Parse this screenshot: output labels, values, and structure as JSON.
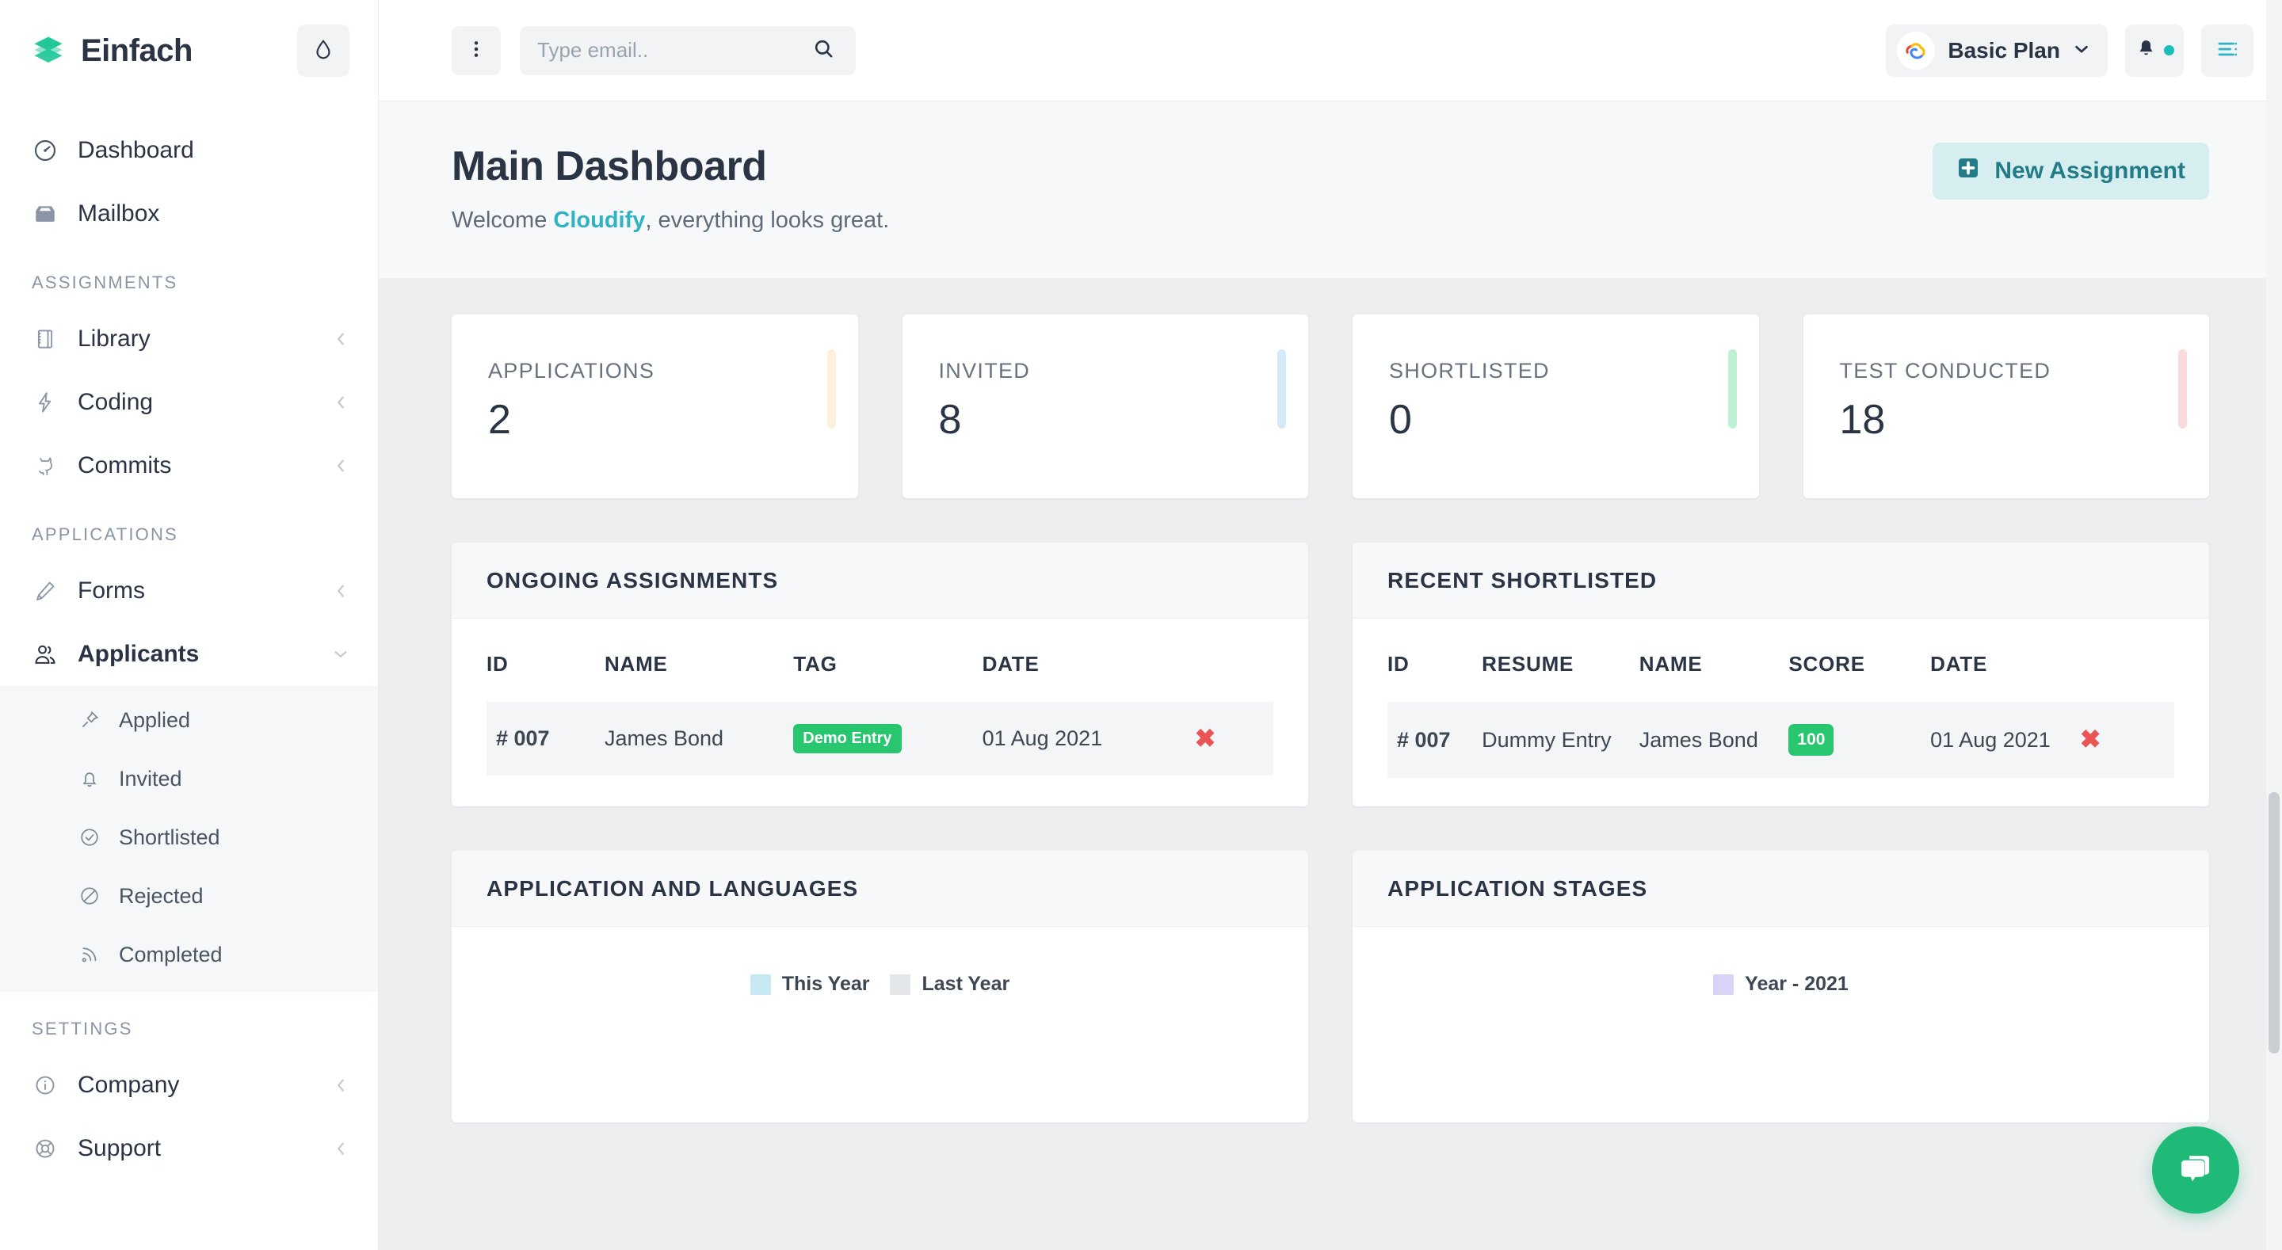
{
  "brand": {
    "name": "Einfach",
    "logo_icon": "layers-icon",
    "theme_toggle_icon": "water-drop-icon"
  },
  "sidebar": {
    "top_items": [
      {
        "label": "Dashboard",
        "icon": "speedometer-icon"
      },
      {
        "label": "Mailbox",
        "icon": "inbox-icon"
      }
    ],
    "sections": [
      {
        "title": "ASSIGNMENTS",
        "items": [
          {
            "label": "Library",
            "icon": "notebook-icon",
            "chevron": "left"
          },
          {
            "label": "Coding",
            "icon": "lightning-bolt-icon",
            "chevron": "left"
          },
          {
            "label": "Commits",
            "icon": "github-cat-icon",
            "chevron": "left"
          }
        ]
      },
      {
        "title": "APPLICATIONS",
        "items": [
          {
            "label": "Forms",
            "icon": "pencil-icon",
            "chevron": "left"
          },
          {
            "label": "Applicants",
            "icon": "users-icon",
            "chevron": "down",
            "active": true
          }
        ],
        "submenu": [
          {
            "label": "Applied",
            "icon": "pin-icon"
          },
          {
            "label": "Invited",
            "icon": "bell-icon"
          },
          {
            "label": "Shortlisted",
            "icon": "check-circle-icon"
          },
          {
            "label": "Rejected",
            "icon": "ban-icon"
          },
          {
            "label": "Completed",
            "icon": "rss-signal-icon"
          }
        ]
      },
      {
        "title": "SETTINGS",
        "items": [
          {
            "label": "Company",
            "icon": "info-circle-icon",
            "chevron": "left"
          },
          {
            "label": "Support",
            "icon": "life-buoy-icon",
            "chevron": "left"
          }
        ]
      }
    ]
  },
  "topbar": {
    "menu_dots_icon": "vertical-dots-icon",
    "search": {
      "placeholder": "Type email..",
      "value": "",
      "icon": "search-icon"
    },
    "plan": {
      "label": "Basic Plan",
      "logo_icon": "cloud-spiral-icon",
      "chevron_icon": "chevron-down-icon"
    },
    "notifications": {
      "icon": "bell-icon",
      "has_badge": true,
      "badge_color": "#17bebb"
    },
    "menu_toggle": {
      "icon": "list-menu-icon",
      "color": "#2fb3c4"
    }
  },
  "page": {
    "title": "Main Dashboard",
    "welcome_prefix": "Welcome ",
    "welcome_name": "Cloudify",
    "welcome_suffix": ", everything looks great.",
    "new_assignment_button": "New Assignment",
    "new_assignment_icon": "plus-square-icon"
  },
  "stats": [
    {
      "label": "APPLICATIONS",
      "value": "2",
      "bar_color": "#fdf0dd"
    },
    {
      "label": "INVITED",
      "value": "8",
      "bar_color": "#d5e9f8"
    },
    {
      "label": "SHORTLISTED",
      "value": "0",
      "bar_color": "#bdf0d5"
    },
    {
      "label": "TEST CONDUCTED",
      "value": "18",
      "bar_color": "#fbdada"
    }
  ],
  "ongoing_assignments": {
    "title": "ONGOING ASSIGNMENTS",
    "columns": [
      "ID",
      "NAME",
      "TAG",
      "DATE",
      ""
    ],
    "rows": [
      {
        "id": "# 007",
        "name": "James Bond",
        "tag": "Demo Entry",
        "date": "01 Aug 2021",
        "delete_icon": "close-x-icon"
      }
    ]
  },
  "recent_shortlisted": {
    "title": "RECENT SHORTLISTED",
    "columns": [
      "ID",
      "RESUME",
      "NAME",
      "SCORE",
      "DATE",
      ""
    ],
    "rows": [
      {
        "id": "# 007",
        "resume": "Dummy Entry",
        "name": "James Bond",
        "score": "100",
        "date": "01 Aug 2021",
        "delete_icon": "close-x-icon"
      }
    ]
  },
  "chart_data": [
    {
      "type": "bar",
      "title": "APPLICATION AND LANGUAGES",
      "legend": [
        {
          "name": "This Year",
          "color": "#c7e9f4"
        },
        {
          "name": "Last Year",
          "color": "#e4e7ea"
        }
      ],
      "legend_position": "top-center",
      "categories": [],
      "series": [
        {
          "name": "This Year",
          "values": []
        },
        {
          "name": "Last Year",
          "values": []
        }
      ],
      "xlabel": "",
      "ylabel": "",
      "grid": false
    },
    {
      "type": "bar",
      "title": "APPLICATION STAGES",
      "legend": [
        {
          "name": "Year -  2021",
          "color": "#d9d4f7"
        }
      ],
      "legend_position": "top-center",
      "categories": [],
      "series": [
        {
          "name": "Year -  2021",
          "values": []
        }
      ],
      "xlabel": "",
      "ylabel": "",
      "grid": false
    }
  ],
  "chat_widget": {
    "icon": "chat-bubbles-icon",
    "color": "#1fb978"
  }
}
